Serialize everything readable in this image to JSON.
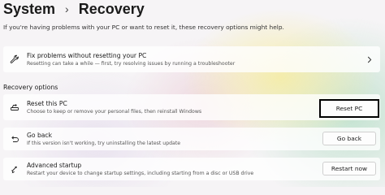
{
  "header": {
    "breadcrumb_root": "System",
    "breadcrumb_separator": "›",
    "page_title": "Recovery"
  },
  "intro_text": "If you're having problems with your PC or want to reset it, these recovery options might help.",
  "fix_card": {
    "icon": "wrench-icon",
    "title": "Fix problems without resetting your PC",
    "subtitle": "Resetting can take a while — first, try resolving issues by running a troubleshooter"
  },
  "section_label": "Recovery options",
  "options": [
    {
      "icon": "reset-pc-icon",
      "title": "Reset this PC",
      "subtitle": "Choose to keep or remove your personal files, then reinstall Windows",
      "button": "Reset PC"
    },
    {
      "icon": "go-back-icon",
      "title": "Go back",
      "subtitle": "If this version isn't working, try uninstalling the latest update",
      "button": "Go back"
    },
    {
      "icon": "advanced-startup-icon",
      "title": "Advanced startup",
      "subtitle": "Restart your device to change startup settings, including starting from a disc or USB drive",
      "button": "Restart now"
    }
  ],
  "colors": {
    "highlight_border": "#000000",
    "button_bg": "#fdfdfd",
    "card_bg": "#ffffff"
  }
}
